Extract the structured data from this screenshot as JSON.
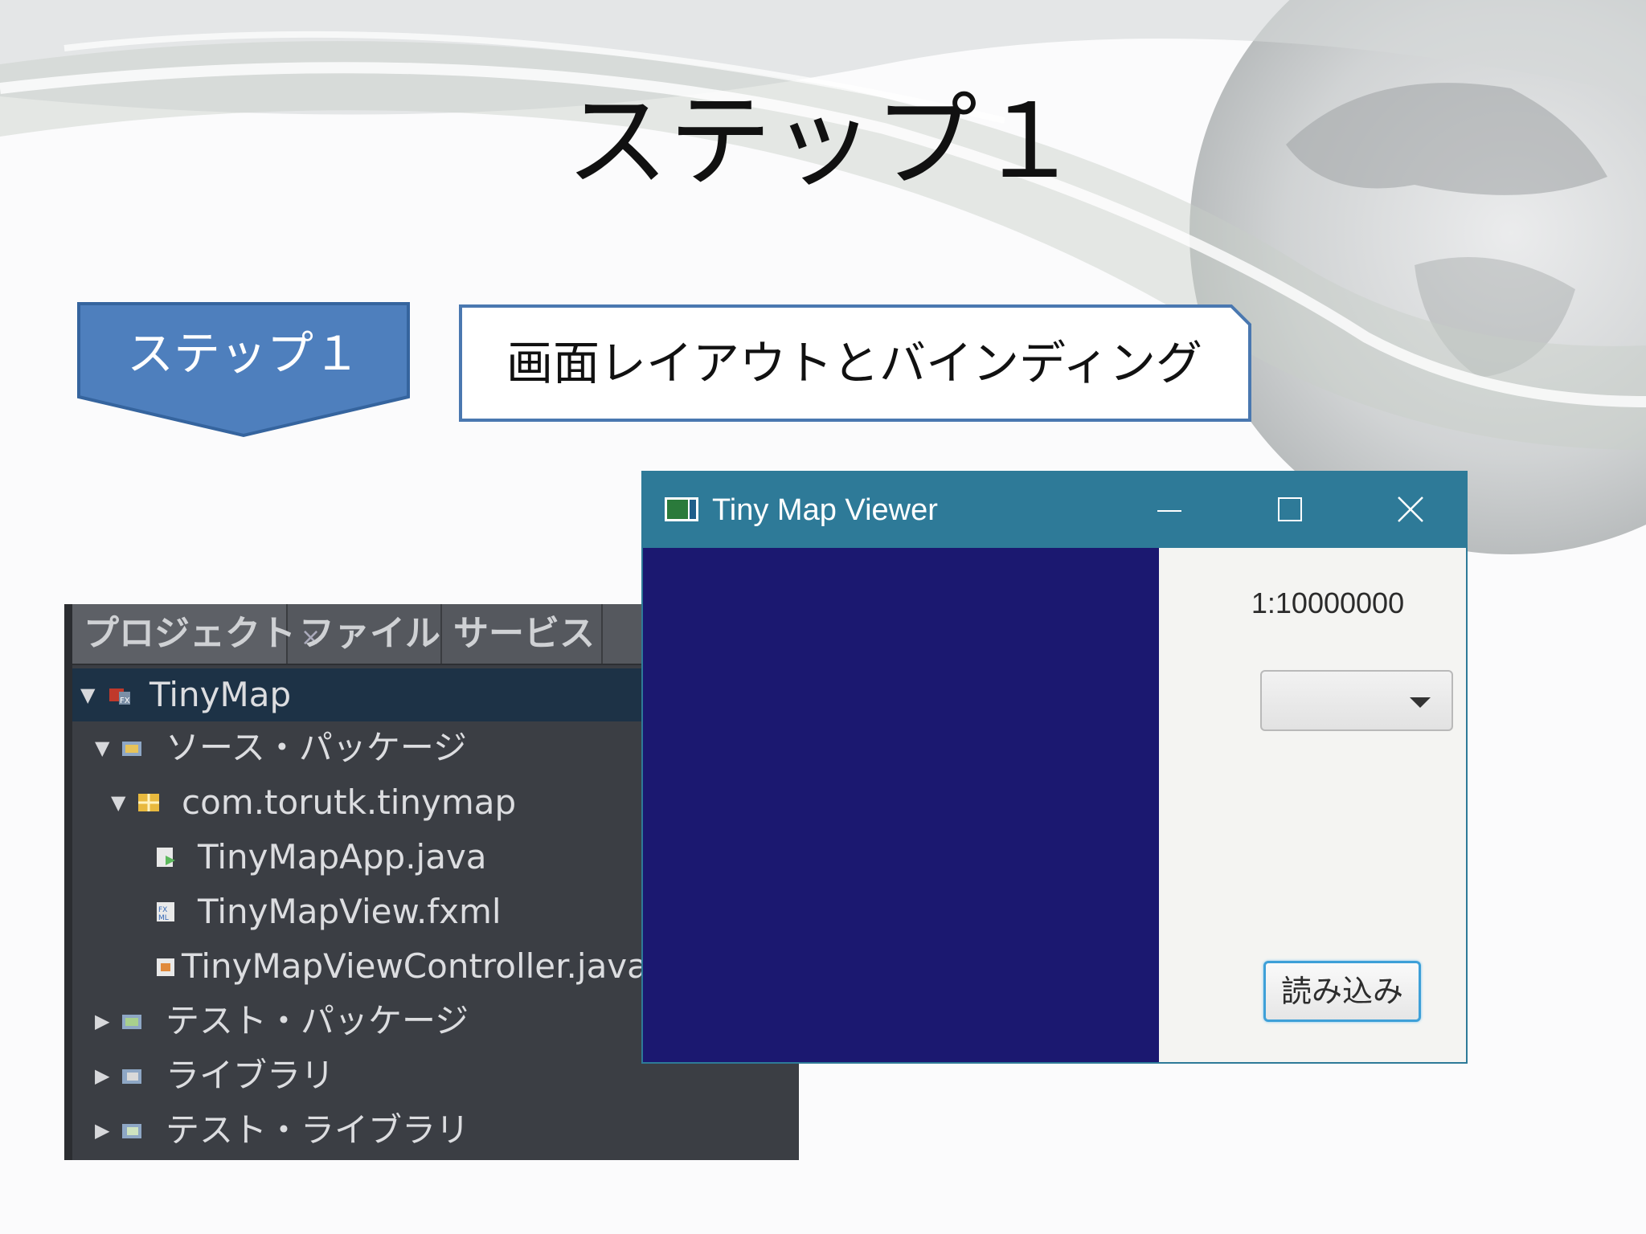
{
  "slide": {
    "title": "ステップ１",
    "step_badge": "ステップ１",
    "step_description": "画面レイアウトとバインディング"
  },
  "ide": {
    "tabs": [
      {
        "label": "プロジェクト",
        "close": "×"
      },
      {
        "label": "ファイル"
      },
      {
        "label": "サービス"
      }
    ],
    "tree": [
      {
        "label": "TinyMap",
        "icon": "javafx-project-icon",
        "expanded": true
      },
      {
        "label": "ソース・パッケージ",
        "icon": "source-packages-icon",
        "expanded": true
      },
      {
        "label": "com.torutk.tinymap",
        "icon": "package-icon",
        "expanded": true
      },
      {
        "label": "TinyMapApp.java",
        "icon": "java-main-class-icon"
      },
      {
        "label": "TinyMapView.fxml",
        "icon": "fxml-file-icon"
      },
      {
        "label": "TinyMapViewController.java",
        "icon": "java-class-icon"
      },
      {
        "label": "テスト・パッケージ",
        "icon": "test-packages-icon",
        "expanded": false
      },
      {
        "label": "ライブラリ",
        "icon": "libraries-icon",
        "expanded": false
      },
      {
        "label": "テスト・ライブラリ",
        "icon": "test-libraries-icon",
        "expanded": false
      }
    ]
  },
  "app_window": {
    "title": "Tiny Map Viewer",
    "scale_label": "1:10000000",
    "combo_value": "",
    "load_button": "読み込み",
    "canvas_color": "#1b1870",
    "titlebar_color": "#2e7a98"
  },
  "colors": {
    "badge_fill": "#4e7fbd",
    "box_border": "#4a78b0"
  }
}
